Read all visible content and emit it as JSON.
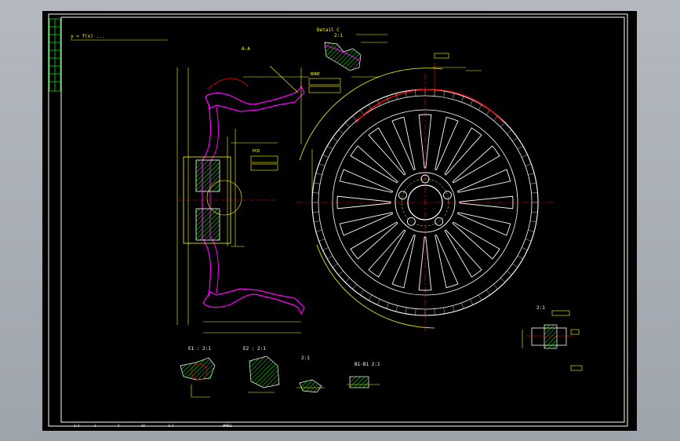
{
  "window": {
    "title": ""
  },
  "colors": {
    "background": "#000000",
    "frame": "#ffffff",
    "dimension": "#ffff00",
    "hatch": "#00ff00",
    "profile": "#ff00ff",
    "highlight": "#ff0000",
    "centerline": "#ff0000",
    "outline": "#ffffff",
    "revision_table": "#00ff00"
  },
  "drawing": {
    "section_label": "A-A",
    "detail_c_label": "Detail C",
    "detail_c_scale": "2:1",
    "notes": [
      "BORE",
      "PCD"
    ],
    "sections": [
      {
        "label": "E1 : 2:1"
      },
      {
        "label": "E2 : 2:1"
      },
      {
        "label": "2:1"
      },
      {
        "label": "B1-B1 2:1"
      }
    ],
    "detail_right_label": "2:1",
    "formula": "y = f(x) ...",
    "title_block": [
      {
        "text": "1:1"
      },
      {
        "text": "1"
      },
      {
        "text": "2"
      },
      {
        "text": "A3"
      },
      {
        "text": "1:1"
      },
      {
        "text": "WHEEL"
      }
    ]
  }
}
